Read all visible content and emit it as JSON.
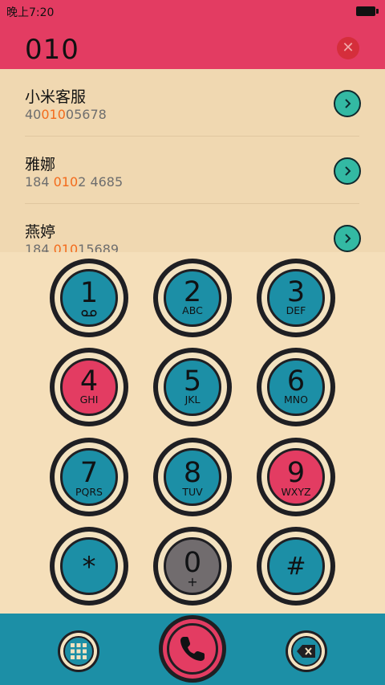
{
  "status_bar": {
    "time": "晚上7:20",
    "icons": [
      "battery-icon"
    ]
  },
  "dialer": {
    "input": "010",
    "clear_icon": "close-icon",
    "clear_glyph": "✕"
  },
  "results": [
    {
      "name": "小米客服",
      "number_before": "40",
      "number_match": "010",
      "number_after": "05678"
    },
    {
      "name": "雅娜",
      "number_before": "184 ",
      "number_match": "010",
      "number_after": "2 4685"
    },
    {
      "name": "燕婷",
      "number_before": "184 ",
      "number_match": "010",
      "number_after": "15689"
    }
  ],
  "keypad": [
    {
      "digit": "1",
      "letters": "",
      "icon": "voicemail-icon"
    },
    {
      "digit": "2",
      "letters": "ABC"
    },
    {
      "digit": "3",
      "letters": "DEF"
    },
    {
      "digit": "4",
      "letters": "GHI"
    },
    {
      "digit": "5",
      "letters": "JKL"
    },
    {
      "digit": "6",
      "letters": "MNO"
    },
    {
      "digit": "7",
      "letters": "PQRS"
    },
    {
      "digit": "8",
      "letters": "TUV"
    },
    {
      "digit": "9",
      "letters": "WXYZ"
    },
    {
      "digit": "",
      "symbol": "*"
    },
    {
      "digit": "0",
      "letters": "+"
    },
    {
      "digit": "",
      "symbol": "#"
    }
  ],
  "bottom_bar": {
    "left_icon": "keypad-icon",
    "center_icon": "phone-icon",
    "right_icon": "backspace-icon"
  },
  "colors": {
    "header": "#E33C62",
    "background": "#F5DFBA",
    "list_background": "#F0D8B1",
    "key_teal": "#1C8FA6",
    "key_pink": "#E33C62",
    "key_gray": "#716C6E",
    "highlight": "#F36B1C",
    "detail_button": "#33B9A3"
  }
}
